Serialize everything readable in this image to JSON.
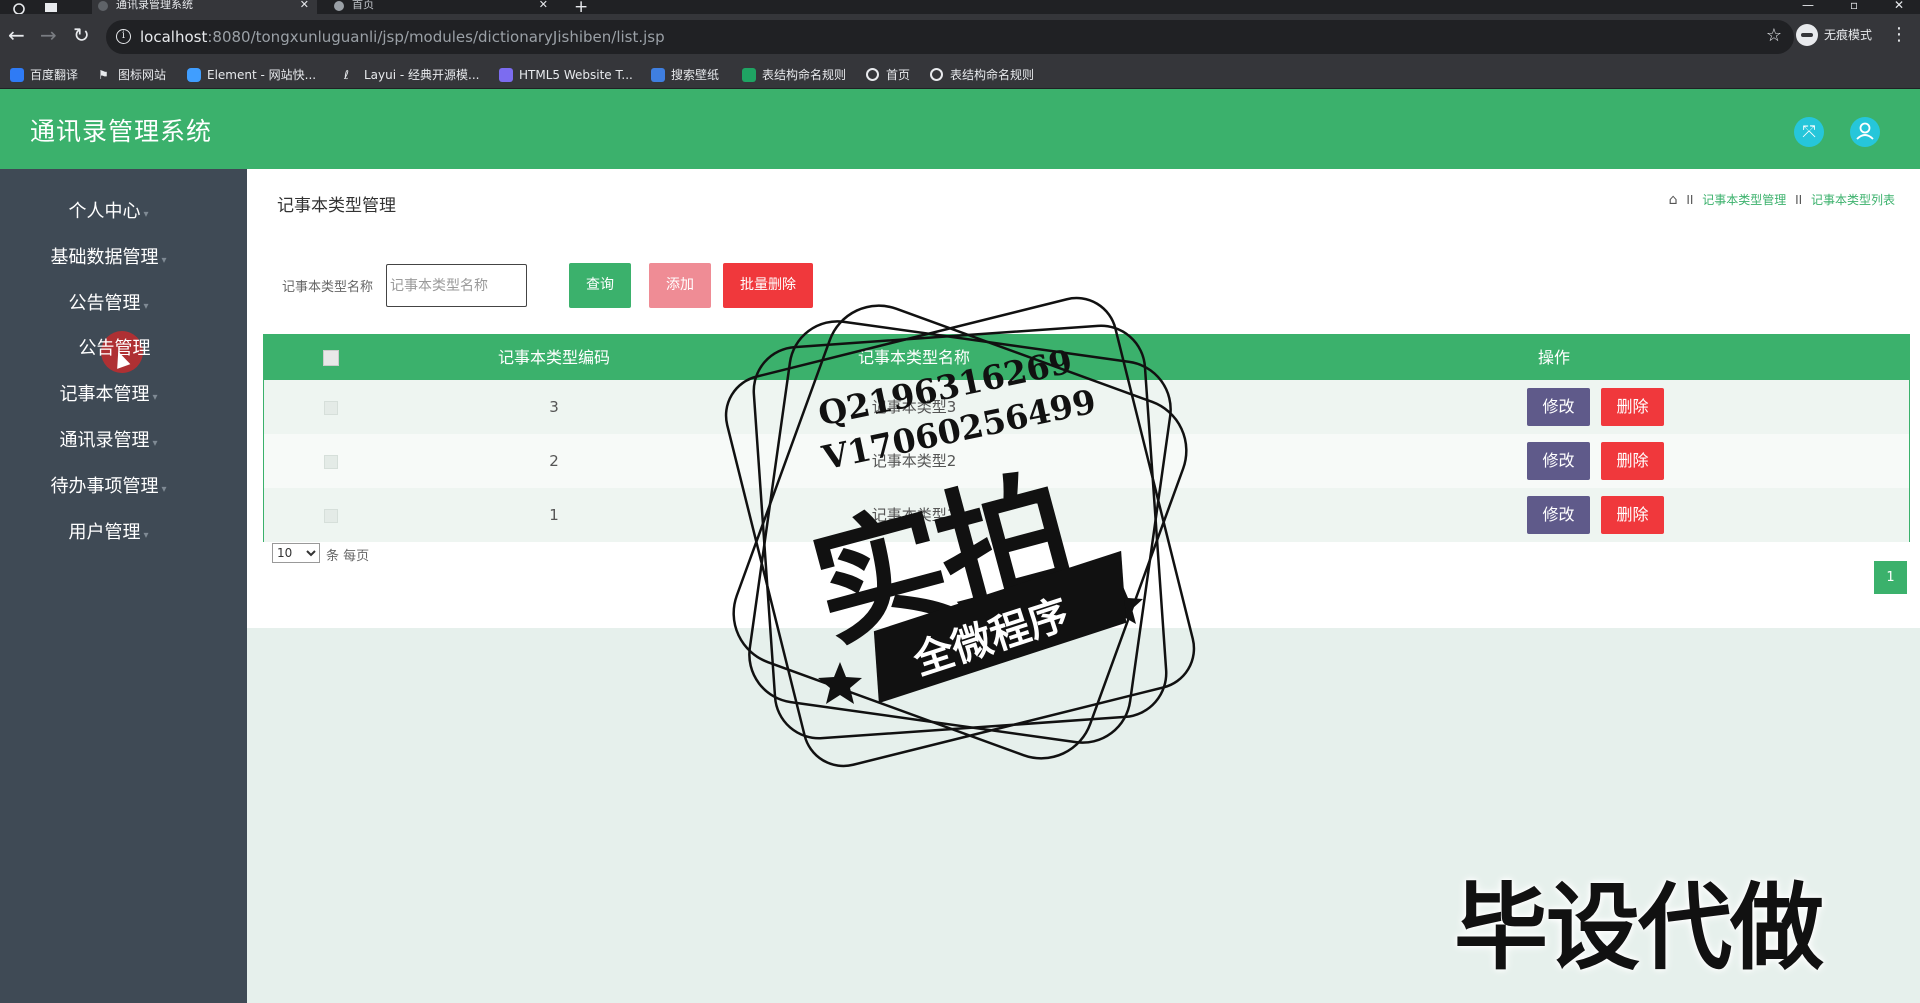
{
  "browser": {
    "tabs": [
      {
        "title": "通讯录管理系统",
        "active": true
      },
      {
        "title": "首页",
        "active": false
      }
    ],
    "new_tab": "+",
    "url_host": "localhost",
    "url_rest": ":8080/tongxunluguanli/jsp/modules/dictionaryJishiben/list.jsp",
    "incognito_label": "无痕模式",
    "bookmarks": [
      {
        "label": "百度翻译",
        "icon": "baidu-translate-icon",
        "color": "#2f7bf5"
      },
      {
        "label": "图标网站",
        "icon": "flag-icon",
        "color": "#e8eaed"
      },
      {
        "label": "Element - 网站快...",
        "icon": "element-icon",
        "color": "#409eff"
      },
      {
        "label": "Layui - 经典开源模...",
        "icon": "layui-icon",
        "color": "#e8eaed"
      },
      {
        "label": "HTML5 Website T...",
        "icon": "html5-icon",
        "color": "#7c6cf0"
      },
      {
        "label": "搜索壁纸",
        "icon": "wallpaper-icon",
        "color": "#3f7fe0"
      },
      {
        "label": "表结构命名规则",
        "icon": "sheet-icon",
        "color": "#1fa463"
      },
      {
        "label": "首页",
        "icon": "globe-icon",
        "color": "#e8eaed"
      },
      {
        "label": "表结构命名规则",
        "icon": "globe-icon",
        "color": "#e8eaed"
      }
    ]
  },
  "app": {
    "title": "通讯录管理系统",
    "header_buttons": {
      "fullscreen": "⤧",
      "user": "👤"
    }
  },
  "sidebar": {
    "items": [
      {
        "label": "个人中心"
      },
      {
        "label": "基础数据管理"
      },
      {
        "label": "公告管理"
      },
      {
        "label": "公告管理"
      },
      {
        "label": "记事本管理"
      },
      {
        "label": "通讯录管理"
      },
      {
        "label": "待办事项管理"
      },
      {
        "label": "用户管理"
      }
    ]
  },
  "main": {
    "page_title": "记事本类型管理",
    "breadcrumb": [
      "记事本类型管理",
      "记事本类型列表"
    ],
    "breadcrumb_sep": "II",
    "search": {
      "label": "记事本类型名称",
      "placeholder": "记事本类型名称",
      "value": ""
    },
    "buttons": {
      "query": "查询",
      "add": "添加",
      "batch_delete": "批量删除"
    },
    "table": {
      "headers": [
        "记事本类型编码",
        "记事本类型名称",
        "操作"
      ],
      "rows": [
        {
          "code": "3",
          "name": "记事本类型3"
        },
        {
          "code": "2",
          "name": "记事本类型2"
        },
        {
          "code": "1",
          "name": "记事本类型1"
        }
      ],
      "edit_label": "修改",
      "delete_label": "删除"
    },
    "pagination": {
      "page_size": "10",
      "per_page_label": "条 每页",
      "current_page": "1"
    }
  },
  "watermark": {
    "line1": "Q2196316269",
    "line2": "V17060256499",
    "big_text": "实拍",
    "ribbon_text": "全微程序",
    "banner": "毕设代做"
  }
}
